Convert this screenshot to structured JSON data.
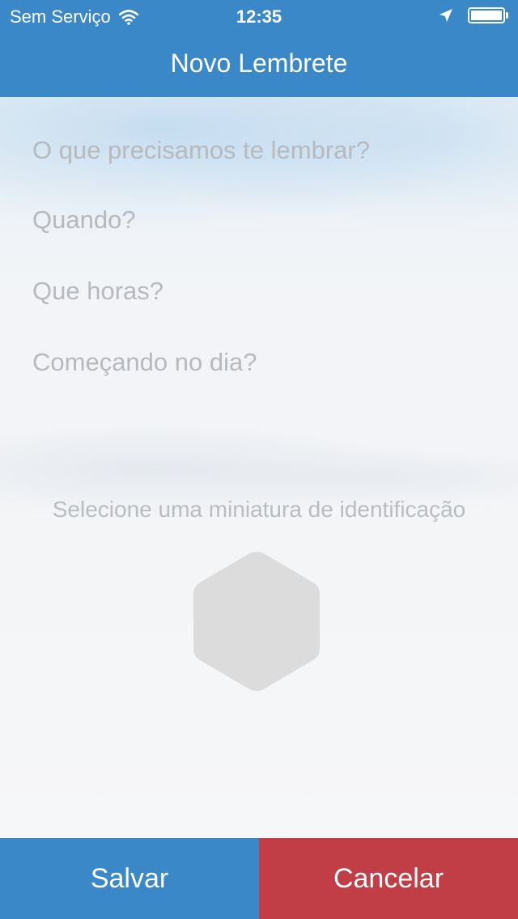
{
  "status_bar": {
    "carrier": "Sem Serviço",
    "time": "12:35",
    "wifi_icon": "wifi-icon",
    "location_icon": "location-arrow-icon",
    "battery_icon": "battery-icon",
    "battery_level": 1.0
  },
  "nav": {
    "title": "Novo Lembrete"
  },
  "form": {
    "what_placeholder": "O que precisamos te lembrar?",
    "when_placeholder": "Quando?",
    "time_placeholder": "Que horas?",
    "start_placeholder": "Começando no dia?"
  },
  "thumbnail": {
    "label": "Selecione uma miniatura de identificação",
    "icon": "hexagon-icon"
  },
  "footer": {
    "save_label": "Salvar",
    "cancel_label": "Cancelar"
  },
  "colors": {
    "primary": "#3a88c8",
    "danger": "#c13e46",
    "placeholder_text": "#b6b9bd",
    "hexagon_fill": "#dcdcdc"
  }
}
